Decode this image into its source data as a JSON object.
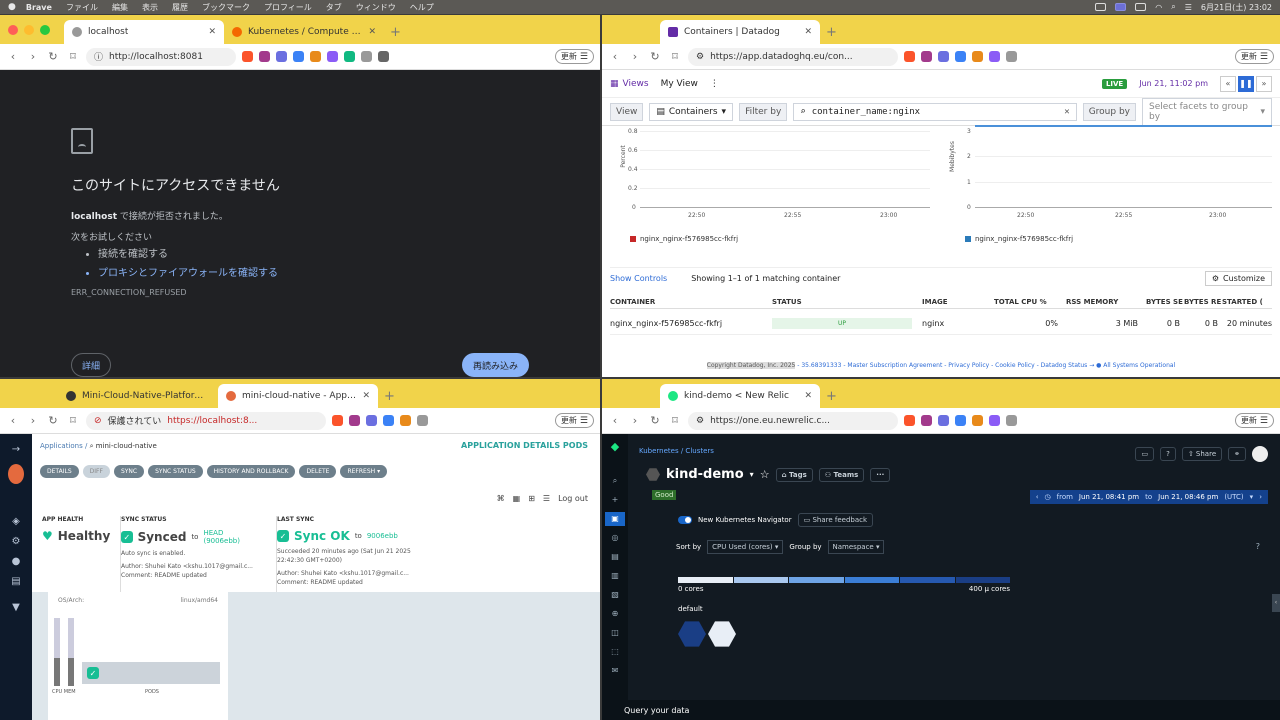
{
  "menubar": {
    "app": "Brave",
    "items": [
      "ファイル",
      "編集",
      "表示",
      "履歴",
      "ブックマーク",
      "プロフィール",
      "タブ",
      "ウィンドウ",
      "ヘルプ"
    ],
    "clock": "6月21日(土) 23:02"
  },
  "tl": {
    "tabs": [
      {
        "label": "localhost"
      },
      {
        "label": "Kubernetes / Compute Resources"
      }
    ],
    "url": "http://localhost:8081",
    "update": "更新",
    "error": {
      "title": "このサイトにアクセスできません",
      "host": "localhost",
      "msg": " で接続が拒否されました。",
      "try": "次をお試しください",
      "li1": "接続を確認する",
      "li2": "プロキシとファイアウォールを確認する",
      "code": "ERR_CONNECTION_REFUSED",
      "details": "詳細",
      "reload": "再読み込み"
    }
  },
  "tr": {
    "tabs": [
      {
        "label": "Containers | Datadog"
      }
    ],
    "url": "https://app.datadoghq.eu/con...",
    "update": "更新",
    "dd": {
      "views": "Views",
      "myview": "My View",
      "live": "LIVE",
      "time": "Jun 21, 11:02 pm",
      "view_label": "View",
      "view_value": "Containers",
      "filter_label": "Filter by",
      "filter_value": "container_name:nginx",
      "group_label": "Group by",
      "group_placeholder": "Select facets to group by",
      "chart1": {
        "ylabel": "Percent",
        "yticks": [
          "0.8",
          "0.6",
          "0.4",
          "0.2",
          "0"
        ],
        "xticks": [
          "22:50",
          "22:55",
          "23:00"
        ],
        "legend": "nginx_nginx-f576985cc-fkfrj"
      },
      "chart2": {
        "ylabel": "Mebibytes",
        "yticks": [
          "3",
          "2",
          "1",
          "0"
        ],
        "xticks": [
          "22:50",
          "22:55",
          "23:00"
        ],
        "legend": "nginx_nginx-f576985cc-fkfrj"
      },
      "show_controls": "Show Controls",
      "showing": "Showing 1–1 of 1 matching container",
      "customize": "Customize",
      "columns": [
        "CONTAINER",
        "STATUS",
        "IMAGE",
        "TOTAL CPU %",
        "RSS MEMORY",
        "BYTES SE",
        "BYTES RE",
        "STARTED ("
      ],
      "row": {
        "container": "nginx_nginx-f576985cc-fkfrj",
        "status": "UP",
        "image": "nginx",
        "cpu": "0%",
        "mem": "3 MiB",
        "bs": "0 B",
        "br": "0 B",
        "started": "20 minutes"
      },
      "footer_cp": "Copyright Datadog, Inc. 2025",
      "footer_rest": " - 35.68391333 - Master Subscription Agreement - Privacy Policy - Cookie Policy - Datadog Status → ● All Systems Operational"
    }
  },
  "bl": {
    "tabs": [
      {
        "label": "Mini-Cloud-Native-Platform/k8s/..."
      },
      {
        "label": "mini-cloud-native - Application..."
      }
    ],
    "url_warn": "保護されてい",
    "url": "https://localhost:8...",
    "update": "更新",
    "argo": {
      "crumb_apps": "Applications",
      "crumb_name": "mini-cloud-native",
      "title": "APPLICATION DETAILS PODS",
      "actions": [
        "DETAILS",
        "DIFF",
        "SYNC",
        "SYNC STATUS",
        "HISTORY AND ROLLBACK",
        "DELETE",
        "REFRESH ▾"
      ],
      "logout": "Log out",
      "health_h": "APP HEALTH",
      "health": "Healthy",
      "sync_h": "SYNC STATUS",
      "sync": "Synced",
      "sync_to": "to",
      "sync_rev": "HEAD (9006ebb)",
      "sync_note": "Auto sync is enabled.",
      "author_l": "Author:",
      "author": "Shuhei Kato <kshu.1017@gmail.c...",
      "comment_l": "Comment:",
      "comment": "README updated",
      "last_h": "LAST SYNC",
      "last": "Sync OK",
      "last_to": "to",
      "last_rev": "9006ebb",
      "last_note": "Succeeded 20 minutes ago (Sat Jun 21 2025 22:42:30 GMT+0200)",
      "os_l": "OS/Arch:",
      "os": "linux/amd64",
      "cpumem": "CPU MEM",
      "pods": "PODS"
    }
  },
  "br": {
    "tabs": [
      {
        "label": "kind-demo < New Relic"
      }
    ],
    "url": "https://one.eu.newrelic.c...",
    "update": "更新",
    "nr": {
      "crumb": "Kubernetes / Clusters",
      "title": "kind-demo",
      "tags": "Tags",
      "teams": "Teams",
      "good": "Good",
      "share": "Share",
      "range_from": "from",
      "range_a": "Jun 21, 08:41 pm",
      "range_to": "to",
      "range_b": "Jun 21, 08:46 pm",
      "range_tz": "(UTC)",
      "navigator": "New Kubernetes Navigator",
      "feedback": "Share feedback",
      "sortby": "Sort by",
      "sort_val": "CPU Used (cores)",
      "groupby": "Group by",
      "group_val": "Namespace",
      "scale_min": "0 cores",
      "scale_max": "400 µ cores",
      "ns": "default",
      "query": "Query your data"
    }
  },
  "colors": {
    "brave_tab": "#f1d34a",
    "dd_purple": "#632ca6",
    "argo_teal": "#18be94",
    "nr_blue": "#1966c8"
  }
}
